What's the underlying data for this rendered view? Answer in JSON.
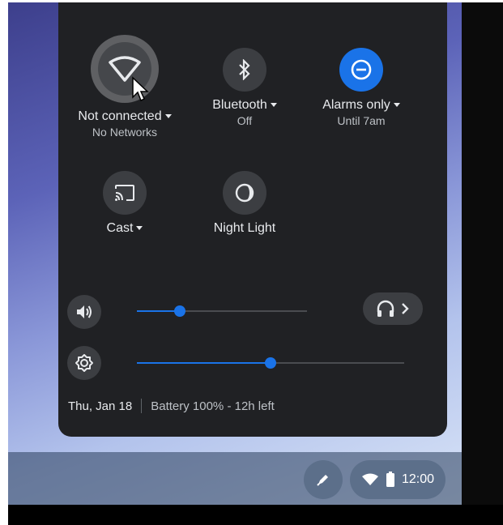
{
  "quick_settings": {
    "network": {
      "label": "Not connected",
      "sublabel": "No Networks",
      "icon": "wifi-off-icon"
    },
    "bluetooth": {
      "label": "Bluetooth",
      "sublabel": "Off",
      "icon": "bluetooth-icon"
    },
    "dnd": {
      "label": "Alarms only",
      "sublabel": "Until 7am",
      "icon": "do-not-disturb-icon",
      "active_color": "#1a73e8"
    },
    "cast": {
      "label": "Cast",
      "icon": "cast-icon"
    },
    "night_light": {
      "label": "Night Light",
      "icon": "night-light-icon"
    }
  },
  "sliders": {
    "volume": {
      "level": 0.25,
      "icon": "volume-icon"
    },
    "brightness": {
      "level": 0.5,
      "icon": "brightness-icon"
    }
  },
  "audio_settings": {
    "icon": "headphones-icon"
  },
  "footer": {
    "date": "Thu, Jan 18",
    "battery": "Battery 100% - 12h left"
  },
  "shelf": {
    "time": "12:00",
    "icons": [
      "stylus-icon",
      "wifi-icon",
      "battery-icon"
    ]
  },
  "colors": {
    "panel": "#202124",
    "accent": "#1a73e8",
    "tile": "#3c3e42"
  }
}
